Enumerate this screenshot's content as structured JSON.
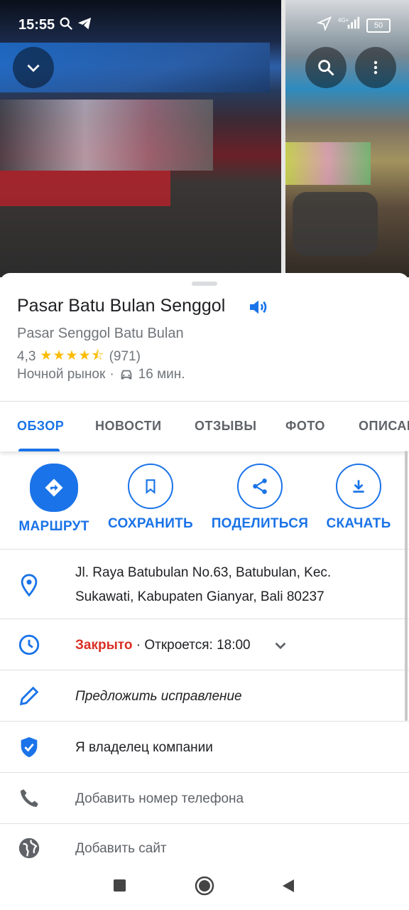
{
  "status_bar": {
    "time": "15:55",
    "network": "4G+",
    "battery": "50"
  },
  "place": {
    "name": "Pasar Batu Bulan Senggol",
    "alt_name": "Pasar Senggol Batu Bulan",
    "rating": "4,3",
    "stars": "★★★★⯪",
    "reviews": "(971)",
    "category": "Ночной рынок",
    "separator": "·",
    "travel_time": "16 мин."
  },
  "tabs": [
    {
      "label": "ОБЗОР"
    },
    {
      "label": "НОВОСТИ"
    },
    {
      "label": "ОТЗЫВЫ"
    },
    {
      "label": "ФОТО"
    },
    {
      "label": "ОПИСАНИЕ"
    }
  ],
  "actions": [
    {
      "label": "МАРШРУТ",
      "icon": "directions-icon"
    },
    {
      "label": "СОХРАНИТЬ",
      "icon": "bookmark-icon"
    },
    {
      "label": "ПОДЕЛИТЬСЯ",
      "icon": "share-icon"
    },
    {
      "label": "СКАЧАТЬ",
      "icon": "download-icon"
    }
  ],
  "details": {
    "address_line1": "Jl. Raya Batubulan No.63, Batubulan, Kec.",
    "address_line2": "Sukawati, Kabupaten Gianyar, Bali 80237",
    "hours_status": "Закрыто",
    "hours_separator": "·",
    "hours_opens": "Откроется: 18:00",
    "suggest_edit": "Предложить исправление",
    "own_business": "Я владелец компании",
    "add_phone": "Добавить номер телефона",
    "add_website": "Добавить сайт"
  },
  "colors": {
    "accent": "#1a73e8",
    "closed": "#d93025",
    "star": "#fbbc04"
  }
}
